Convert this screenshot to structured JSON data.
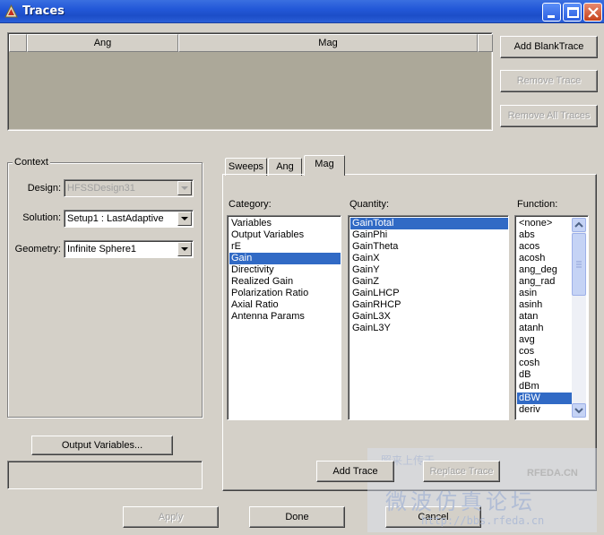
{
  "window": {
    "title": "Traces"
  },
  "trace_table": {
    "columns": [
      "",
      "Ang",
      "Mag"
    ]
  },
  "trace_buttons": {
    "add_blank": "Add BlankTrace",
    "remove": "Remove Trace",
    "remove_all": "Remove All Traces"
  },
  "context": {
    "legend": "Context",
    "design_label": "Design:",
    "design_value": "HFSSDesign31",
    "solution_label": "Solution:",
    "solution_value": "Setup1 : LastAdaptive",
    "geometry_label": "Geometry:",
    "geometry_value": "Infinite Sphere1"
  },
  "output_variables_button": "Output Variables...",
  "tabs": [
    "Sweeps",
    "Ang",
    "Mag"
  ],
  "active_tab": "Mag",
  "panel": {
    "category_label": "Category:",
    "quantity_label": "Quantity:",
    "function_label": "Function:",
    "categories": [
      "Variables",
      "Output Variables",
      "rE",
      "Gain",
      "Directivity",
      "Realized Gain",
      "Polarization Ratio",
      "Axial Ratio",
      "Antenna Params"
    ],
    "selected_category": "Gain",
    "quantities": [
      "GainTotal",
      "GainPhi",
      "GainTheta",
      "GainX",
      "GainY",
      "GainZ",
      "GainLHCP",
      "GainRHCP",
      "GainL3X",
      "GainL3Y"
    ],
    "selected_quantity": "GainTotal",
    "functions": [
      "<none>",
      "abs",
      "acos",
      "acosh",
      "ang_deg",
      "ang_rad",
      "asin",
      "asinh",
      "atan",
      "atanh",
      "avg",
      "cos",
      "cosh",
      "dB",
      "dBm",
      "dBW",
      "deriv"
    ],
    "selected_function": "dBW",
    "add_trace": "Add Trace",
    "replace_trace": "Replace Trace"
  },
  "footer": {
    "apply": "Apply",
    "done": "Done",
    "cancel": "Cancel"
  },
  "watermark": {
    "line1": "照来上传于",
    "logo": "RFEDA.CN",
    "line2": "微波仿真论坛",
    "url": "http://bbs.rfeda.cn"
  }
}
